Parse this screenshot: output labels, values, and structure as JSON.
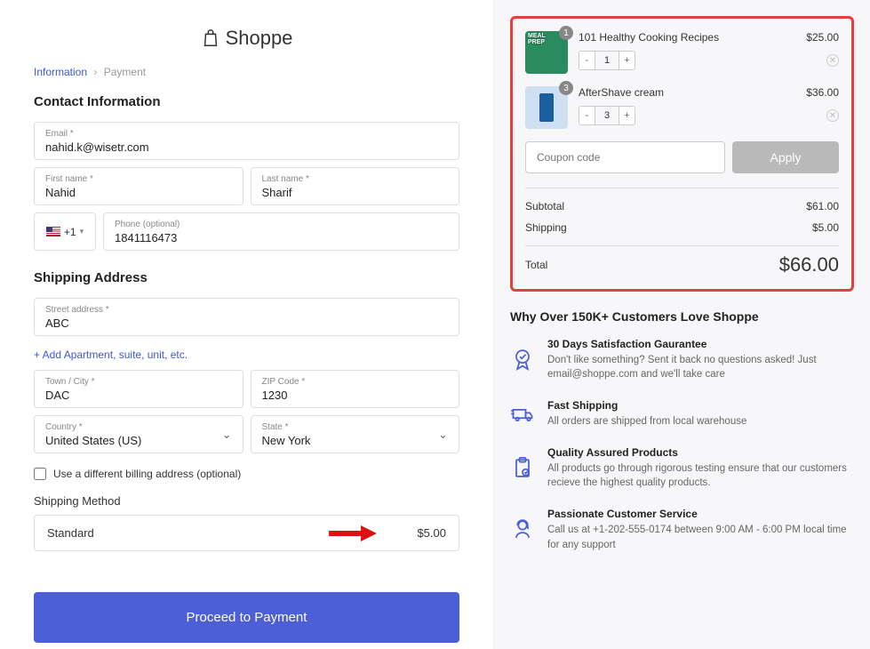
{
  "logo": {
    "text": "Shoppe"
  },
  "breadcrumb": {
    "info": "Information",
    "payment": "Payment"
  },
  "contact": {
    "heading": "Contact Information",
    "email_label": "Email *",
    "email": "nahid.k@wisetr.com",
    "first_label": "First name *",
    "first": "Nahid",
    "last_label": "Last name *",
    "last": "Sharif",
    "phone_code": "+1",
    "phone_label": "Phone (optional)",
    "phone": "1841116473"
  },
  "shipping": {
    "heading": "Shipping Address",
    "street_label": "Street address *",
    "street": "ABC",
    "add_apt": "+ Add Apartment, suite, unit, etc.",
    "city_label": "Town / City *",
    "city": "DAC",
    "zip_label": "ZIP Code *",
    "zip": "1230",
    "country_label": "Country *",
    "country": "United States (US)",
    "state_label": "State *",
    "state": "New York",
    "diff_billing": "Use a different billing address (optional)",
    "method_heading": "Shipping Method",
    "method_name": "Standard",
    "method_price": "$5.00"
  },
  "proceed_label": "Proceed to Payment",
  "cart": {
    "items": [
      {
        "title": "101 Healthy Cooking Recipes",
        "price": "$25.00",
        "qty": "1",
        "badge": "1"
      },
      {
        "title": "AfterShave cream",
        "price": "$36.00",
        "qty": "3",
        "badge": "3"
      }
    ],
    "coupon_placeholder": "Coupon code",
    "apply_label": "Apply",
    "subtotal_label": "Subtotal",
    "subtotal": "$61.00",
    "shipping_label": "Shipping",
    "shipping": "$5.00",
    "total_label": "Total",
    "total": "$66.00"
  },
  "why": {
    "heading": "Why Over 150K+ Customers Love Shoppe",
    "features": [
      {
        "title": "30 Days Satisfaction Gaurantee",
        "body": "Don't like something? Sent it back no questions asked! Just email@shoppe.com and we'll take care"
      },
      {
        "title": "Fast Shipping",
        "body": "All orders are shipped from local warehouse"
      },
      {
        "title": "Quality Assured Products",
        "body": "All products go through rigorous testing ensure that our customers recieve the highest quality products."
      },
      {
        "title": "Passionate Customer Service",
        "body": "Call us at +1-202-555-0174 between 9:00 AM - 6:00 PM local time for any support"
      }
    ]
  }
}
